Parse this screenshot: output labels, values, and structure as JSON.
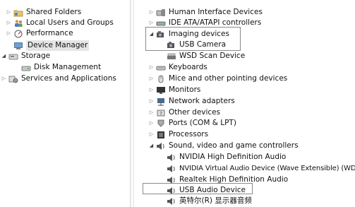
{
  "left_tree": [
    {
      "label": "Shared Folders",
      "icon": "shared-folder-icon",
      "arrow": "▷"
    },
    {
      "label": "Local Users and Groups",
      "icon": "users-icon",
      "arrow": "▷"
    },
    {
      "label": "Performance",
      "icon": "performance-icon",
      "arrow": "▷"
    },
    {
      "label": "Device Manager",
      "icon": "device-manager-icon",
      "arrow": "",
      "selected": true
    },
    {
      "label": "Storage",
      "icon": "storage-icon",
      "arrow": "◢"
    },
    {
      "label": "Disk Management",
      "icon": "disk-icon",
      "arrow": ""
    },
    {
      "label": "Services and Applications",
      "icon": "services-icon",
      "arrow": "▷"
    }
  ],
  "device_tree": [
    {
      "label": "Human Interface Devices",
      "icon": "hid-icon",
      "arrow": "▷"
    },
    {
      "label": "IDE ATA/ATAPI controllers",
      "icon": "ide-icon",
      "arrow": "▷"
    },
    {
      "label": "Imaging devices",
      "icon": "camera-icon",
      "arrow": "◢"
    },
    {
      "label": "USB Camera",
      "icon": "camera-icon",
      "arrow": ""
    },
    {
      "label": "WSD Scan Device",
      "icon": "scanner-icon",
      "arrow": ""
    },
    {
      "label": "Keyboards",
      "icon": "keyboard-icon",
      "arrow": "▷"
    },
    {
      "label": "Mice and other pointing devices",
      "icon": "mouse-icon",
      "arrow": "▷"
    },
    {
      "label": "Monitors",
      "icon": "monitor-icon",
      "arrow": "▷"
    },
    {
      "label": "Network adapters",
      "icon": "network-icon",
      "arrow": "▷"
    },
    {
      "label": "Other devices",
      "icon": "other-devices-icon",
      "arrow": "▷"
    },
    {
      "label": "Ports (COM & LPT)",
      "icon": "port-icon",
      "arrow": "▷"
    },
    {
      "label": "Processors",
      "icon": "processor-icon",
      "arrow": "▷"
    },
    {
      "label": "Sound, video and game controllers",
      "icon": "speaker-icon",
      "arrow": "◢"
    },
    {
      "label": "NVIDIA High Definition Audio",
      "icon": "speaker-icon",
      "arrow": ""
    },
    {
      "label": "NVIDIA Virtual Audio Device (Wave Extensible) (WDM)",
      "icon": "speaker-icon",
      "arrow": ""
    },
    {
      "label": "Realtek High Definition Audio",
      "icon": "speaker-icon",
      "arrow": ""
    },
    {
      "label": "USB Audio Device",
      "icon": "speaker-icon",
      "arrow": ""
    },
    {
      "label": "英特尔(R) 显示器音频",
      "icon": "speaker-icon",
      "arrow": ""
    }
  ]
}
